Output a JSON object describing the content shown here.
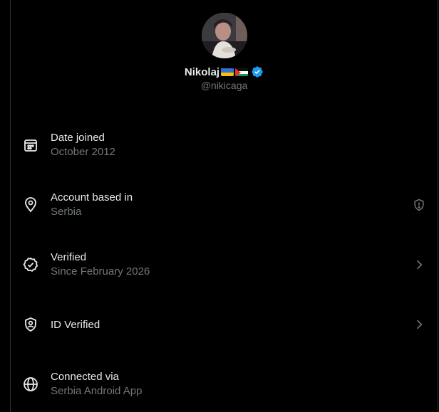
{
  "profile": {
    "name": "Nikolaj",
    "handle": "@nikicaga",
    "flags": [
      "ukraine-flag",
      "palestine-flag"
    ],
    "verified_badge": "verified-badge-icon"
  },
  "rows": [
    {
      "label": "Date joined",
      "sub": "October 2012",
      "icon": "calendar-icon",
      "trail": ""
    },
    {
      "label": "Account based in",
      "sub": "Serbia",
      "icon": "location-pin-icon",
      "trail": "shield-info-icon"
    },
    {
      "label": "Verified",
      "sub": "Since February 2026",
      "icon": "verified-check-icon",
      "trail": "chevron-right-icon"
    },
    {
      "label": "ID Verified",
      "sub": "",
      "icon": "id-shield-icon",
      "trail": "chevron-right-icon"
    },
    {
      "label": "Connected via",
      "sub": "Serbia Android App",
      "icon": "globe-icon",
      "trail": ""
    }
  ],
  "colors": {
    "background": "#000000",
    "text_primary": "#e7e9ea",
    "text_secondary": "#71767b",
    "verified_blue": "#1d9bf0",
    "border": "#2f3336"
  }
}
